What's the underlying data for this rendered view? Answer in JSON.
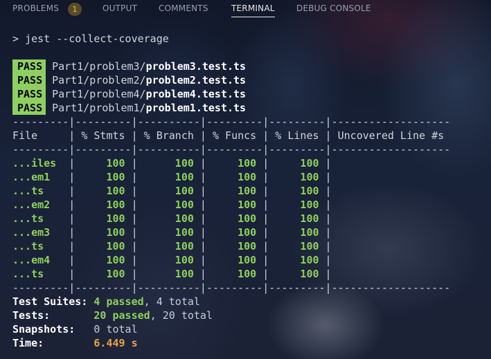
{
  "tabs": {
    "problems": "PROBLEMS",
    "problems_count": "1",
    "output": "OUTPUT",
    "comments": "COMMENTS",
    "terminal": "TERMINAL",
    "debug_console": "DEBUG CONSOLE"
  },
  "terminal": {
    "prompt": ">",
    "command": "jest --collect-coverage",
    "pass_label": "PASS",
    "pass_lines": [
      {
        "dir": "Part1/problem3/",
        "file": "problem3.test.ts"
      },
      {
        "dir": "Part1/problem2/",
        "file": "problem2.test.ts"
      },
      {
        "dir": "Part1/problem4/",
        "file": "problem4.test.ts"
      },
      {
        "dir": "Part1/problem1/",
        "file": "problem1.test.ts"
      }
    ],
    "coverage": {
      "headers": [
        "File",
        "% Stmts",
        "% Branch",
        "% Funcs",
        "% Lines",
        "Uncovered Line #s"
      ],
      "rows": [
        [
          "...iles",
          "100",
          "100",
          "100",
          "100",
          ""
        ],
        [
          "...em1",
          "100",
          "100",
          "100",
          "100",
          ""
        ],
        [
          "...ts",
          "100",
          "100",
          "100",
          "100",
          ""
        ],
        [
          "...em2",
          "100",
          "100",
          "100",
          "100",
          ""
        ],
        [
          "...ts",
          "100",
          "100",
          "100",
          "100",
          ""
        ],
        [
          "...em3",
          "100",
          "100",
          "100",
          "100",
          ""
        ],
        [
          "...ts",
          "100",
          "100",
          "100",
          "100",
          ""
        ],
        [
          "...em4",
          "100",
          "100",
          "100",
          "100",
          ""
        ],
        [
          "...ts",
          "100",
          "100",
          "100",
          "100",
          ""
        ]
      ]
    },
    "summary": {
      "suites_label": "Test Suites:",
      "suites_passed": "4 passed",
      "suites_total": ", 4 total",
      "tests_label": "Tests:",
      "tests_passed": "20 passed",
      "tests_total": ", 20 total",
      "snapshots_label": "Snapshots:",
      "snapshots_value": "0 total",
      "time_label": "Time:",
      "time_value": "6.449 s"
    }
  }
}
